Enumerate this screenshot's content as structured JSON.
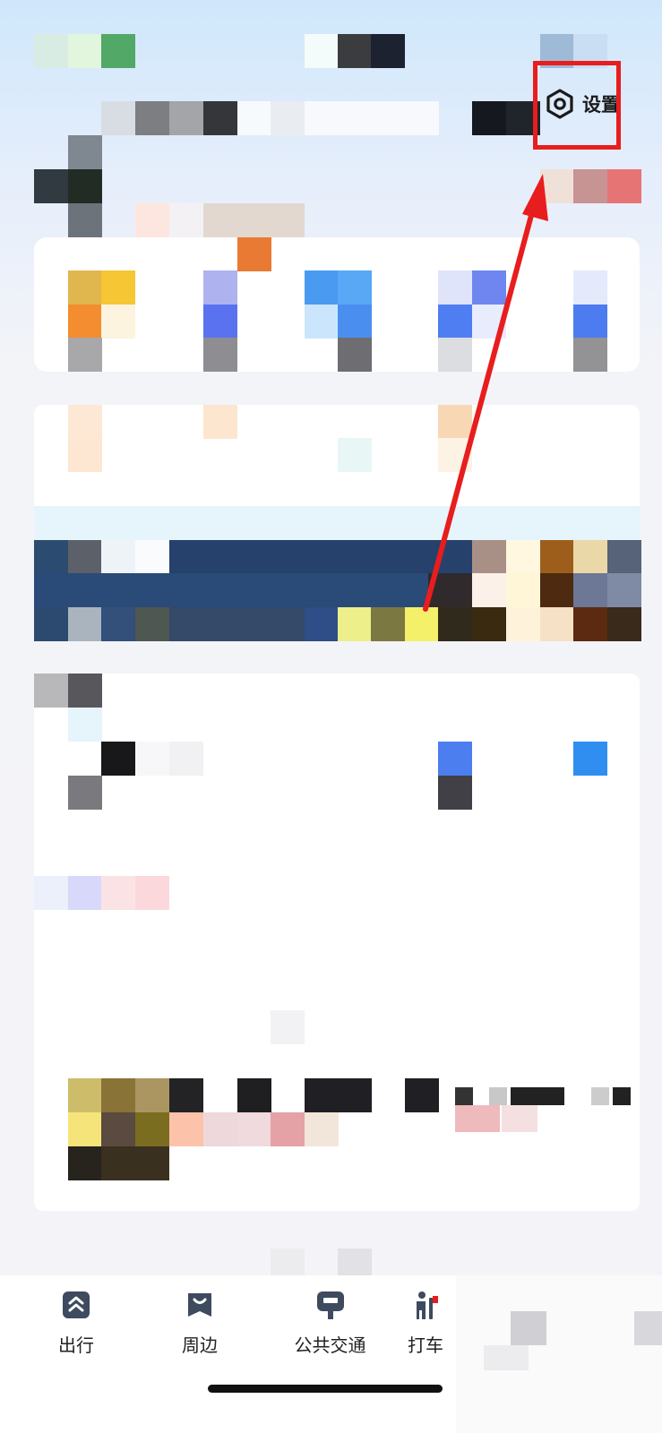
{
  "header": {
    "settings_label": "设置",
    "settings_icon": "gear-hexagon-icon"
  },
  "annotation": {
    "highlight_color": "#e81d1d",
    "arrow_color": "#e81d1d"
  },
  "bottom_nav": {
    "items": [
      {
        "label": "出行",
        "icon": "travel-chevrons-icon"
      },
      {
        "label": "周边",
        "icon": "nearby-bag-icon"
      },
      {
        "label": "公共交通",
        "icon": "bus-stop-icon"
      },
      {
        "label": "打车",
        "icon": "taxi-person-icon"
      }
    ]
  },
  "colors": {
    "accent_blue": "#3c7cf0",
    "dark_navy": "#23426e",
    "text_primary": "#222222"
  }
}
